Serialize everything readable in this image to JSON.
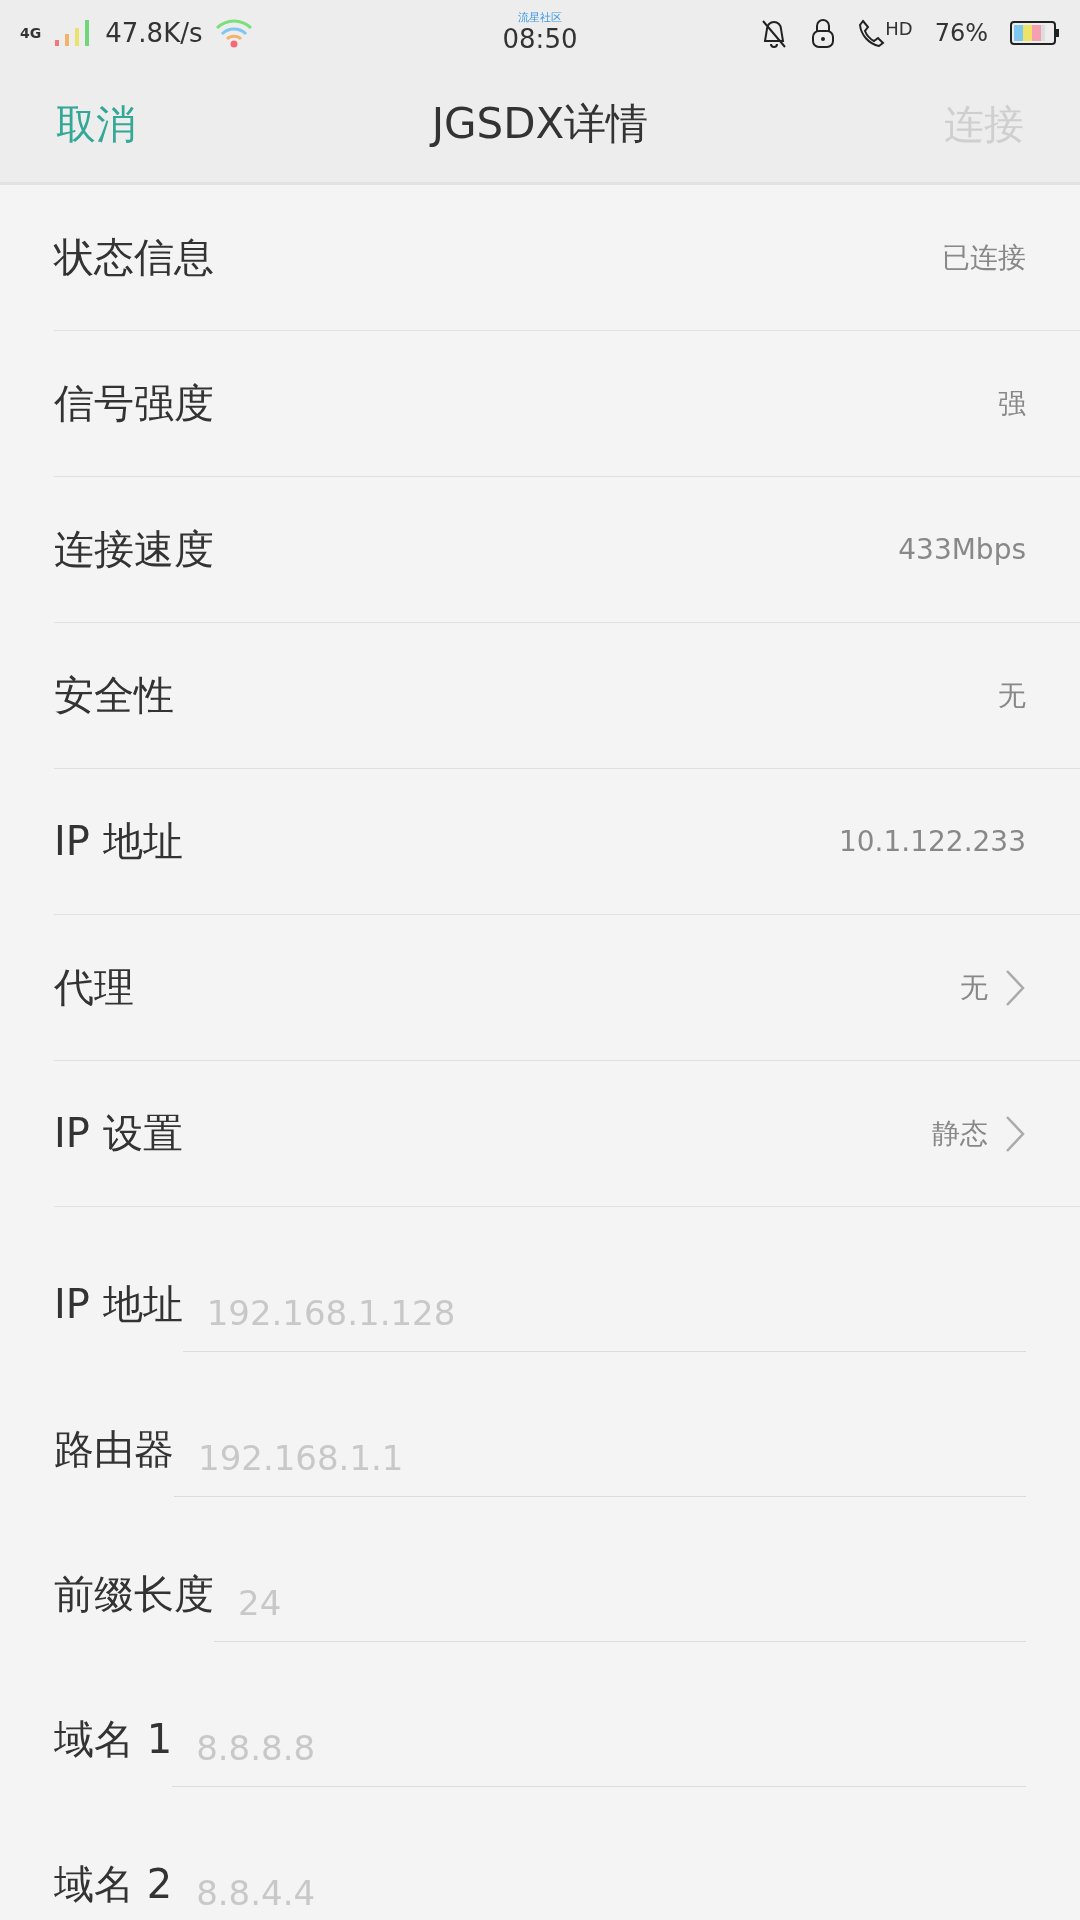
{
  "status_bar": {
    "network": "4G",
    "speed": "47.8K/s",
    "carrier_note": "流星社区",
    "time": "08:50",
    "hd": "HD",
    "battery": "76%"
  },
  "header": {
    "cancel": "取消",
    "title": "JGSDX详情",
    "connect": "连接",
    "connect_disabled": true
  },
  "info_rows": [
    {
      "label": "状态信息",
      "value": "已连接",
      "kind": "info"
    },
    {
      "label": "信号强度",
      "value": "强",
      "kind": "info"
    },
    {
      "label": "连接速度",
      "value": "433Mbps",
      "kind": "info"
    },
    {
      "label": "安全性",
      "value": "无",
      "kind": "info"
    },
    {
      "label": "IP 地址",
      "value": "10.1.122.233",
      "kind": "info"
    },
    {
      "label": "代理",
      "value": "无",
      "kind": "link"
    },
    {
      "label": "IP 设置",
      "value": "静态",
      "kind": "link"
    }
  ],
  "fields": [
    {
      "label": "IP 地址",
      "placeholder": "192.168.1.128"
    },
    {
      "label": "路由器",
      "placeholder": "192.168.1.1"
    },
    {
      "label": "前缀长度",
      "placeholder": "24"
    },
    {
      "label": "域名 1",
      "placeholder": "8.8.8.8"
    },
    {
      "label": "域名 2",
      "placeholder": "8.8.4.4"
    }
  ]
}
